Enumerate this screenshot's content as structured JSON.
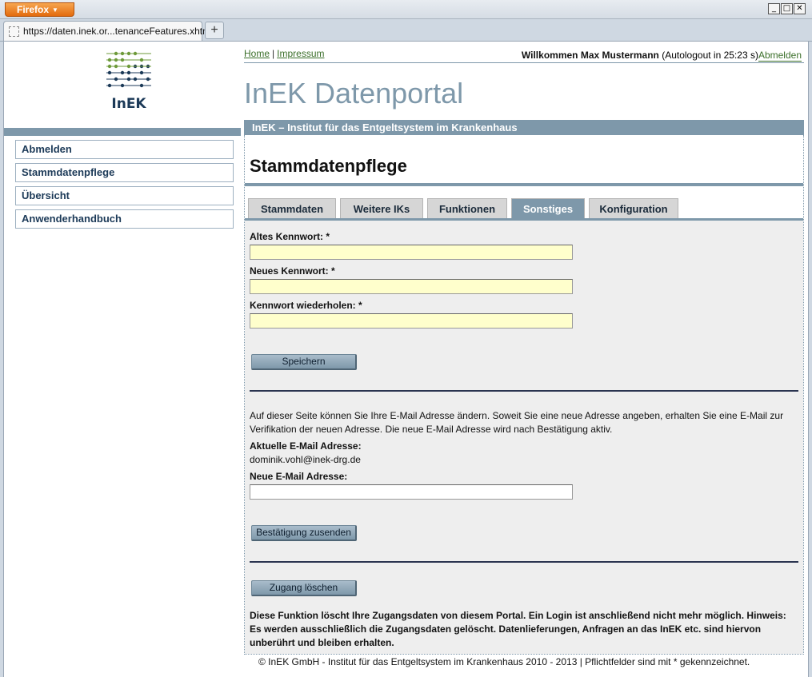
{
  "browser": {
    "menu_label": "Firefox",
    "menu_arrow": "▼",
    "tab_title": "https://daten.inek.or...tenanceFeatures.xhtml",
    "new_tab": "+",
    "controls": {
      "minimize": "_",
      "maximize": "□",
      "close": "✕"
    }
  },
  "header": {
    "logo_text": "InEK",
    "links": [
      "Home",
      "Impressum"
    ],
    "link_separator": "|",
    "welcome_bold": "Willkommen Max Mustermann",
    "autologout": "(Autologout in   25:23 s)",
    "logout_link": "Abmelden",
    "portal_title": "InEK Datenportal",
    "institute": "InEK – Institut für das Entgeltsystem im Krankenhaus"
  },
  "sidebar": {
    "items": [
      "Abmelden",
      "Stammdatenpflege",
      "Übersicht",
      "Anwenderhandbuch"
    ]
  },
  "main": {
    "heading": "Stammdatenpflege",
    "tabs": [
      "Stammdaten",
      "Weitere IKs",
      "Funktionen",
      "Sonstiges",
      "Konfiguration"
    ],
    "active_tab": "Sonstiges",
    "password": {
      "old_label": "Altes Kennwort: *",
      "new_label": "Neues Kennwort: *",
      "repeat_label": "Kennwort wiederholen: *",
      "save_button": "Speichern"
    },
    "email": {
      "info": "Auf dieser Seite können Sie Ihre E-Mail Adresse ändern. Soweit Sie eine neue Adresse angeben, erhalten Sie eine E-Mail zur Verifikation der neuen Adresse. Die neue E-Mail Adresse wird nach Bestätigung aktiv.",
      "current_label": "Aktuelle E-Mail Adresse:",
      "current_value": "dominik.vohl@inek-drg.de",
      "new_label": "Neue E-Mail Adresse:",
      "confirm_button": "Bestätigung zusenden"
    },
    "delete": {
      "button": "Zugang löschen",
      "note": "Diese Funktion löscht Ihre Zugangsdaten von diesem Portal. Ein Login ist anschließend nicht mehr möglich. Hinweis: Es werden ausschließlich die Zugangsdaten gelöscht. Datenlieferungen, Anfragen an das InEK etc. sind hiervon unberührt und bleiben erhalten."
    }
  },
  "footer": "© InEK GmbH - Institut für das Entgeltsystem im Krankenhaus 2010 - 2013 | Pflichtfelder sind mit * gekennzeichnet.",
  "colors": {
    "accent": "#7e98aa",
    "link": "#3b6f2a",
    "input_highlight": "#ffffcc",
    "panel": "#eeeeee"
  }
}
